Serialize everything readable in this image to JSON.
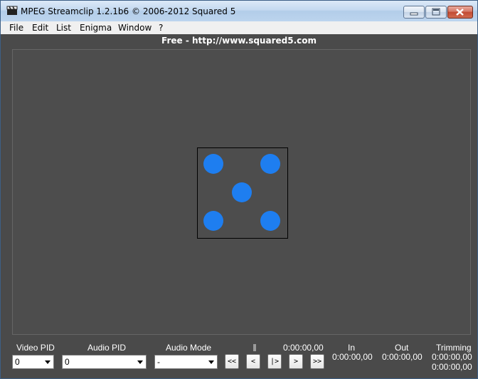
{
  "window": {
    "title": "MPEG Streamclip 1.2.1b6  ©  2006-2012 Squared 5",
    "controls": [
      "minimize-icon",
      "maximize-icon",
      "close-icon"
    ]
  },
  "menu": [
    "File",
    "Edit",
    "List",
    "Enigma",
    "Window",
    "?"
  ],
  "headline": "Free  -  http://www.squared5.com",
  "preview": {
    "pip_color": "#1e7ef0",
    "pip_count": 5
  },
  "controls": {
    "video_pid": {
      "label": "Video PID",
      "value": "0"
    },
    "audio_pid": {
      "label": "Audio PID",
      "value": "0"
    },
    "audio_mode": {
      "label": "Audio Mode",
      "value": "-"
    },
    "current_time": "0:00:00,00",
    "transport": [
      "<<",
      "<",
      "|>",
      ">",
      ">>"
    ],
    "in": {
      "label": "In",
      "value": "0:00:00,00"
    },
    "out": {
      "label": "Out",
      "value": "0:00:00,00"
    },
    "trimming": {
      "label": "Trimming",
      "value1": "0:00:00,00",
      "value2": "0:00:00,00"
    }
  }
}
